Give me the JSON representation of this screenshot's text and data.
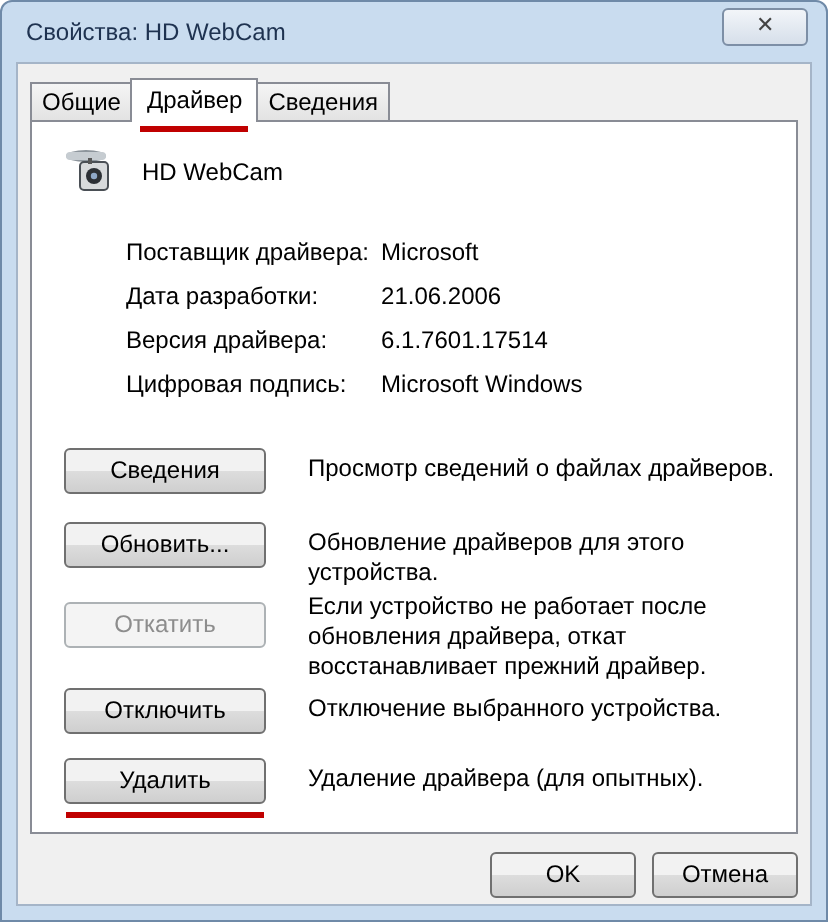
{
  "window": {
    "title": "Свойства: HD WebCam",
    "close": "✕"
  },
  "tabs": [
    {
      "label": "Общие",
      "selected": false,
      "underlined": false
    },
    {
      "label": "Драйвер",
      "selected": true,
      "underlined": true
    },
    {
      "label": "Сведения",
      "selected": false,
      "underlined": false
    }
  ],
  "device": {
    "name": "HD WebCam"
  },
  "info": [
    {
      "label": "Поставщик драйвера:",
      "value": "Microsoft"
    },
    {
      "label": "Дата разработки:",
      "value": "21.06.2006"
    },
    {
      "label": "Версия драйвера:",
      "value": "6.1.7601.17514"
    },
    {
      "label": "Цифровая подпись:",
      "value": "Microsoft Windows"
    }
  ],
  "actions": [
    {
      "button": "Сведения",
      "description": "Просмотр сведений о файлах драйверов.",
      "disabled": false,
      "underlined": false
    },
    {
      "button": "Обновить...",
      "description": "Обновление драйверов для этого устройства.",
      "disabled": false,
      "underlined": false
    },
    {
      "button": "Откатить",
      "description": "Если устройство не работает после обновления драйвера, откат восстанавливает прежний драйвер.",
      "disabled": true,
      "underlined": false
    },
    {
      "button": "Отключить",
      "description": "Отключение выбранного устройства.",
      "disabled": false,
      "underlined": false
    },
    {
      "button": "Удалить",
      "description": "Удаление драйвера (для опытных).",
      "disabled": false,
      "underlined": true
    }
  ],
  "footer_buttons": [
    "OK",
    "Отмена"
  ]
}
